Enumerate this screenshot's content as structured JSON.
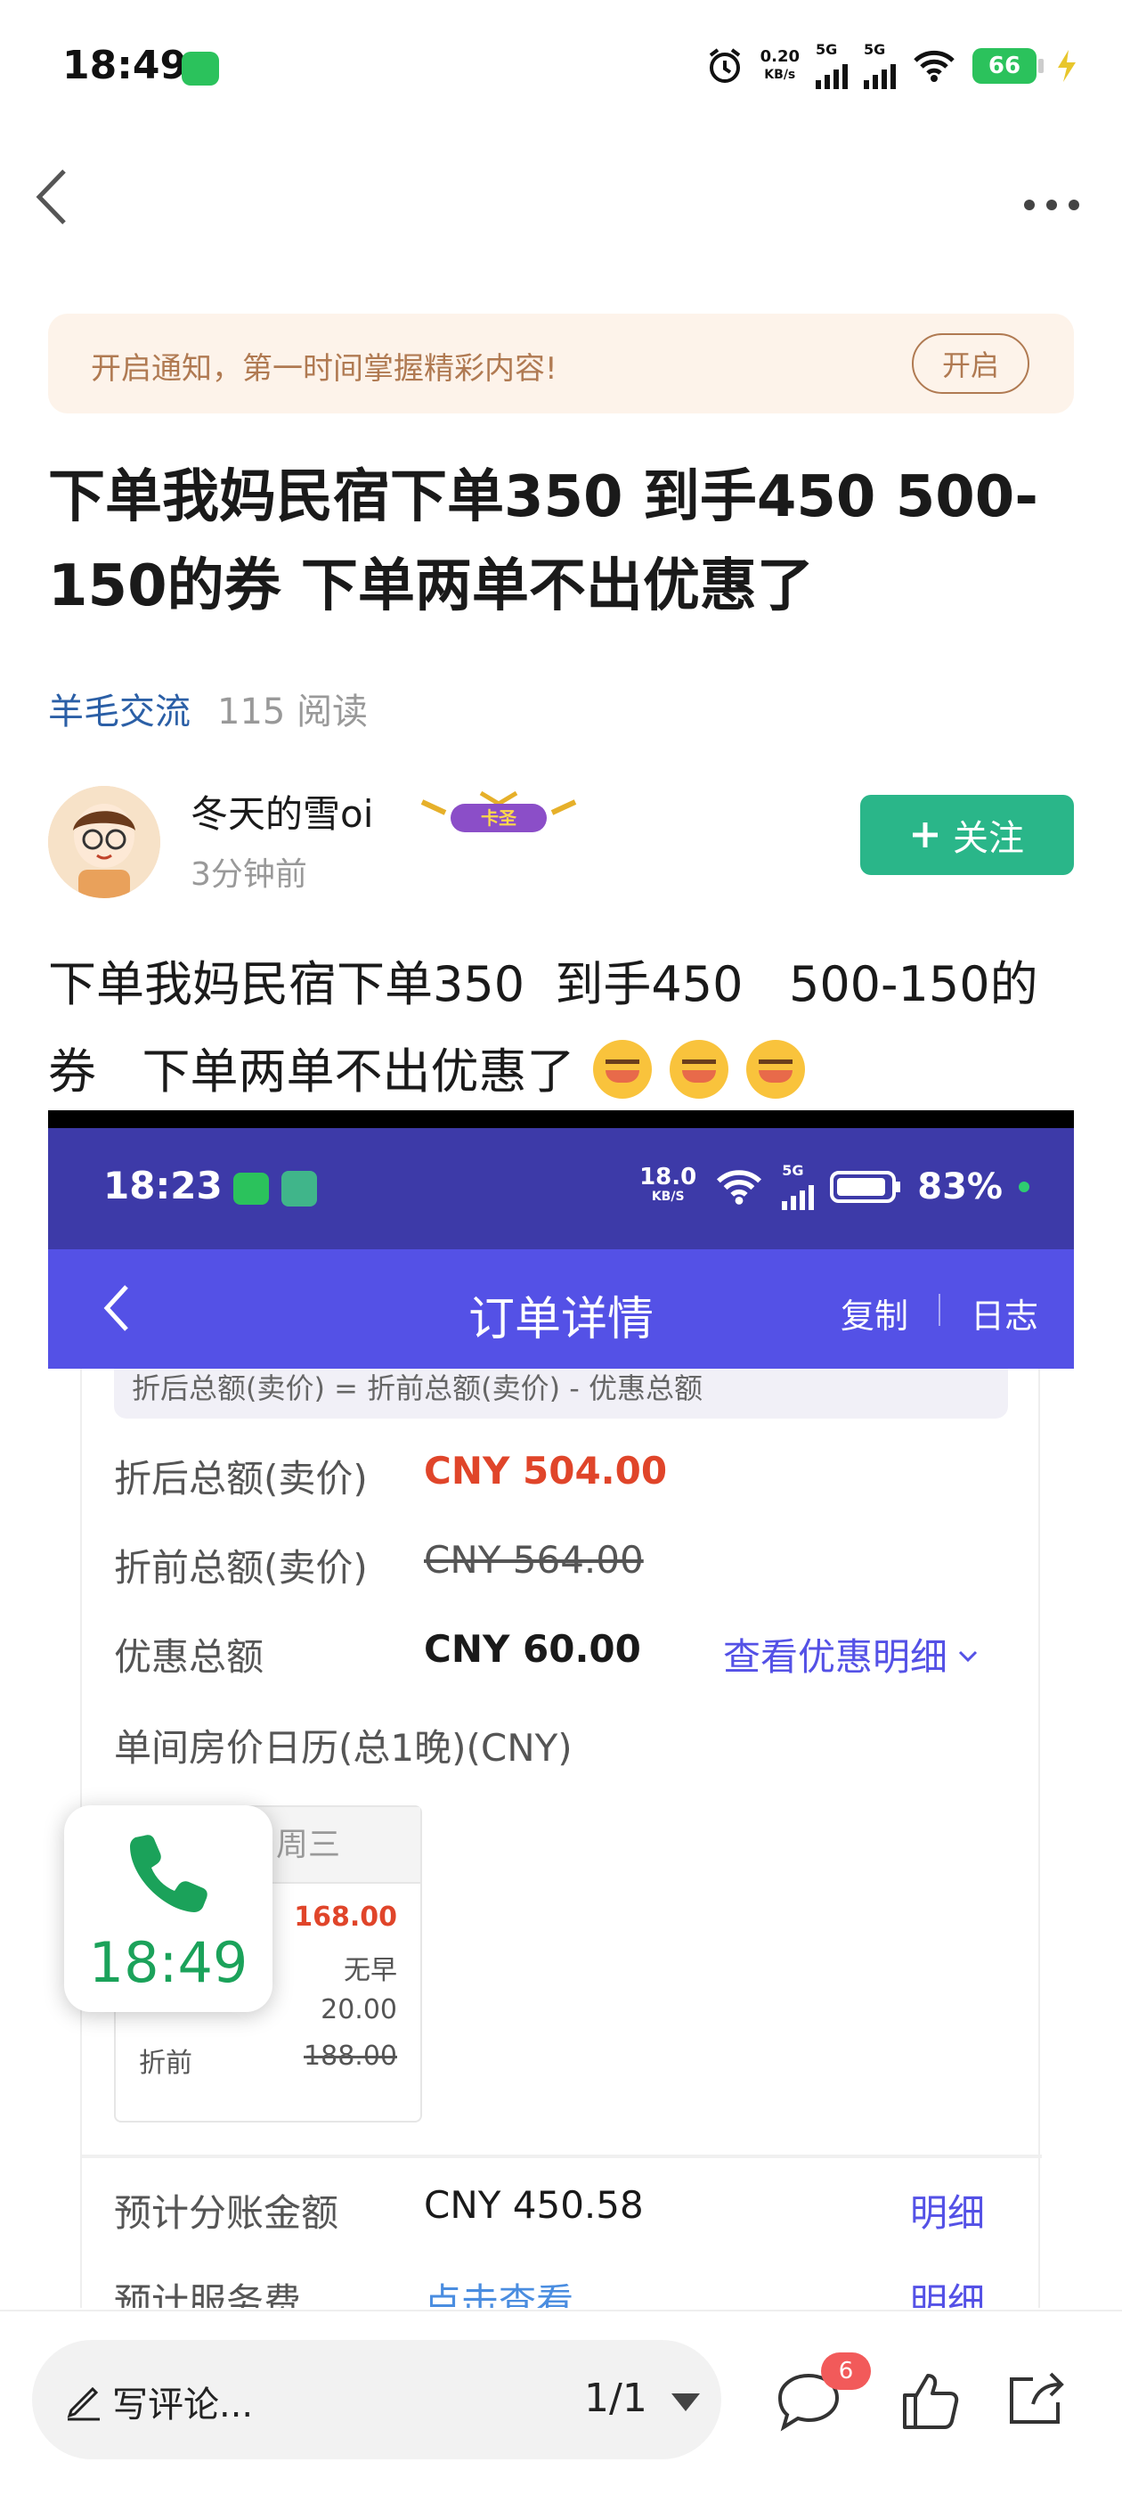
{
  "status_bar": {
    "time": "18:49",
    "speed_top": "0.20",
    "speed_unit": "KB/s",
    "net1": "5G",
    "net2": "5G",
    "battery": "66"
  },
  "notice": {
    "text": "开启通知，第一时间掌握精彩内容!",
    "button": "开启"
  },
  "post": {
    "title": "下单我妈民宿下单350 到手450 500-150的券 下单两单不出优惠了",
    "category": "羊毛交流",
    "reads": "115 阅读",
    "author": {
      "name": "冬天的雪oi",
      "badge": "卡圣",
      "time": "3分钟前",
      "follow": "关注"
    },
    "body_line1": "下单我妈民宿下单350  到手450   500-150的",
    "body_line2": "券   下单两单不出优惠了"
  },
  "screenshot": {
    "status_time": "18:23",
    "status_speed": "18.0",
    "status_speed_unit": "KB/S",
    "status_net": "5G",
    "status_battery": "83%",
    "nav_title": "订单详情",
    "nav_copy": "复制",
    "nav_log": "日志",
    "formula": "折后总额(卖价) = 折前总额(卖价) - 优惠总额",
    "after_label": "折后总额(卖价)",
    "after_value": "CNY 504.00",
    "before_label": "折前总额(卖价)",
    "before_value": "CNY 564.00",
    "discount_label": "优惠总额",
    "discount_value": "CNY 60.00",
    "discount_link": "查看优惠明细",
    "calendar_label": "单间房价日历(总1晚)(CNY)",
    "calendar_day": "周三",
    "calendar_price": "168.00",
    "calendar_breakfast": "无早",
    "calendar_discount": "20.00",
    "calendar_before_label": "折前",
    "calendar_before": "188.00",
    "split_label": "预计分账金额",
    "split_value": "CNY 450.58",
    "split_link": "明细",
    "fee_label": "预计服务费",
    "fee_value": "点击查看",
    "fee_link": "明细"
  },
  "call_bubble": {
    "time": "18:49"
  },
  "bottom_bar": {
    "comment_placeholder": "写评论...",
    "page": "1/1",
    "comment_count": "6"
  }
}
